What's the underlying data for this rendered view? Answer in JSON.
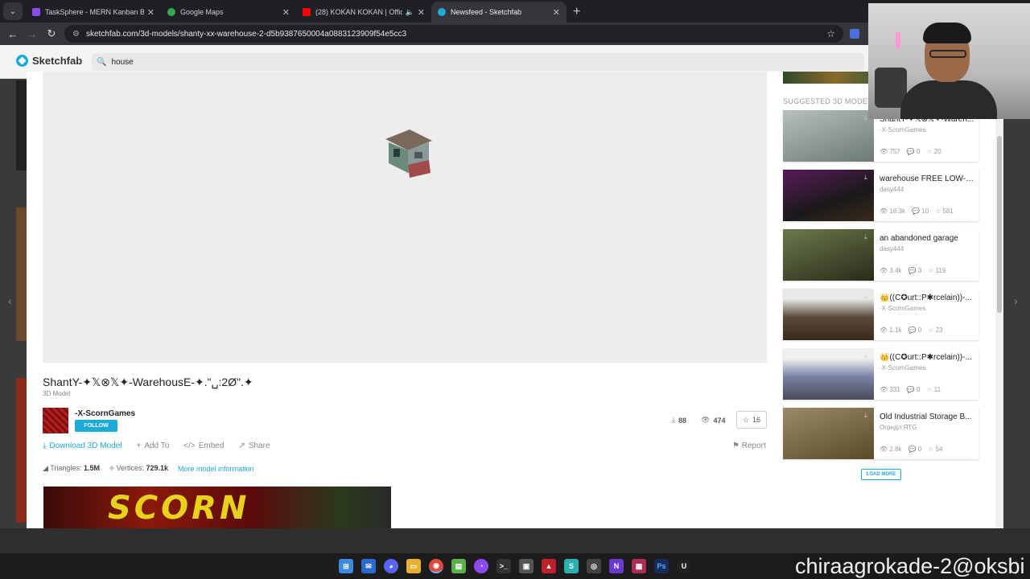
{
  "browser": {
    "tabs": [
      {
        "title": "TaskSphere - MERN Kanban Bo",
        "color": "#8a4cf0",
        "active": false
      },
      {
        "title": "Google Maps",
        "color": "#34a853",
        "active": false
      },
      {
        "title": "(28) KOKAN KOKAN | Offici",
        "color": "#ff0000",
        "active": false
      },
      {
        "title": "Newsfeed - Sketchfab",
        "color": "#1caad9",
        "active": true
      }
    ],
    "url": "sketchfab.com/3d-models/shanty-xx-warehouse-2-d5b9387650004a0883123909f54e5cc3"
  },
  "sketchfab": {
    "logo": "Sketchfab",
    "search_value": "house"
  },
  "model": {
    "title": "ShantY-✦𝕏⊗𝕏✦-WarehousE-✦.\"␣:2Ø\".✦",
    "subtitle": "3D Model",
    "author": "-X-ScornGames",
    "follow_label": "FOLLOW",
    "downloads": "88",
    "views": "474",
    "likes": "16",
    "actions": {
      "download": "Download 3D Model",
      "add_to": "Add To",
      "embed": "Embed",
      "share": "Share",
      "report": "Report"
    },
    "meta": {
      "triangles_label": "Triangles:",
      "triangles": "1.5M",
      "vertices_label": "Vertices:",
      "vertices": "729.1k",
      "more": "More model information"
    },
    "banner_text": "SCORN"
  },
  "suggested": {
    "title": "SUGGESTED 3D MODELS",
    "items": [
      {
        "name": "ShantY-✦𝕏⊗𝕏✦-Waren...",
        "by": "-X-ScornGames",
        "views": "757",
        "comments": "0",
        "likes": "20",
        "thumb": "#9aa7a0"
      },
      {
        "name": "warehouse FREE LOW-P...",
        "by": "dasy444",
        "views": "18.3k",
        "comments": "10",
        "likes": "581",
        "thumb": "#3a1a3a"
      },
      {
        "name": "an abandoned garage",
        "by": "dasy444",
        "views": "3.4k",
        "comments": "3",
        "likes": "119",
        "thumb": "#4a5a3a"
      },
      {
        "name": "👑((C✪urt::P✱rcelain))-...",
        "by": "-X-ScornGames",
        "views": "1.1k",
        "comments": "0",
        "likes": "23",
        "thumb": "#5a4a3a"
      },
      {
        "name": "👑((C✪urt::P✱rcelain))-...",
        "by": "-X-ScornGames",
        "views": "331",
        "comments": "0",
        "likes": "11",
        "thumb": "#8a94b4"
      },
      {
        "name": "Old Industrial Storage B...",
        "by": "Огрндл ЯТG",
        "views": "2.8k",
        "comments": "0",
        "likes": "54",
        "thumb": "#7a6a4a"
      }
    ],
    "load_more": "LOAD MORE"
  },
  "watermark": "chiraagrokade-2@oksbi",
  "taskbar": [
    "windows-icon",
    "outlook-icon",
    "discord-icon",
    "folder-icon",
    "chrome-icon",
    "notepad-icon",
    "github-icon",
    "terminal-icon",
    "app-icon",
    "app2-icon",
    "app3-icon",
    "search-app-icon",
    "vs-icon",
    "app4-icon",
    "photoshop-icon",
    "unreal-icon"
  ]
}
